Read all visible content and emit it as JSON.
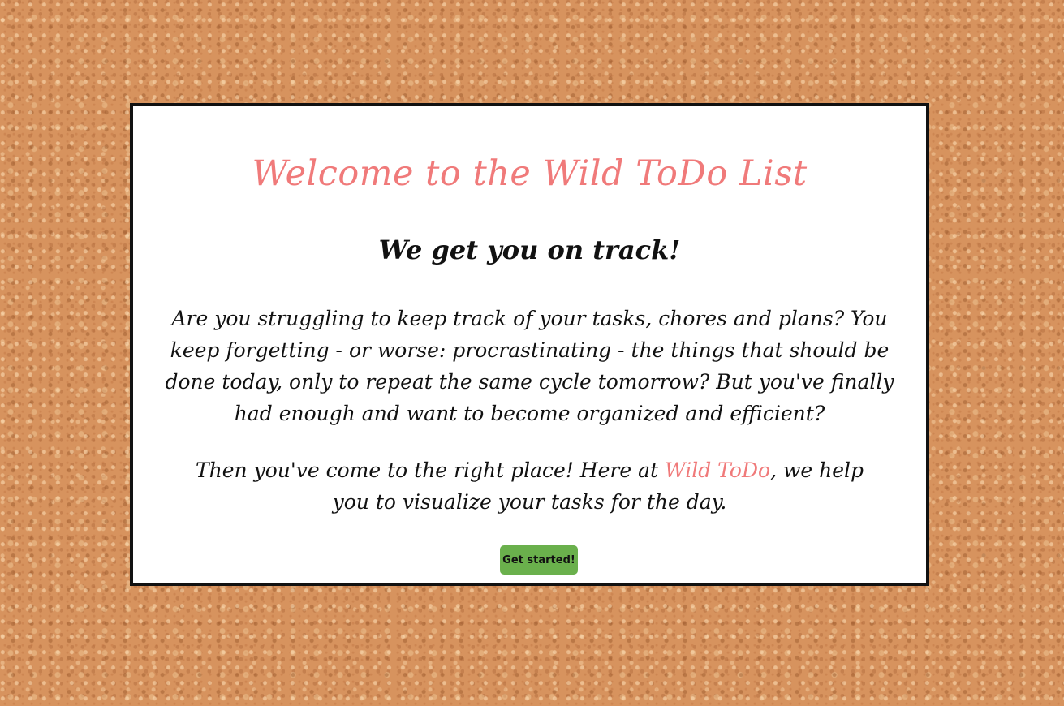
{
  "welcome": {
    "title": "Welcome to the Wild ToDo List",
    "subtitle": "We get you on track!",
    "intro": "Are you struggling to keep track of your tasks, chores and plans? You keep forgetting - or worse: procrastinating - the things that should be done today, only to repeat the same cycle tomorrow? But you've finally had enough and want to become organized and efficient?",
    "pitch_before": "Then you've come to the right place! Here at ",
    "brand_name": "Wild ToDo",
    "pitch_after": ", we help you to visualize your tasks for the day.",
    "button_label": "Get started!"
  },
  "colors": {
    "accent": "#f07a7a",
    "button": "#6ab04c",
    "card_border": "#111111",
    "background": "#d7935e"
  }
}
